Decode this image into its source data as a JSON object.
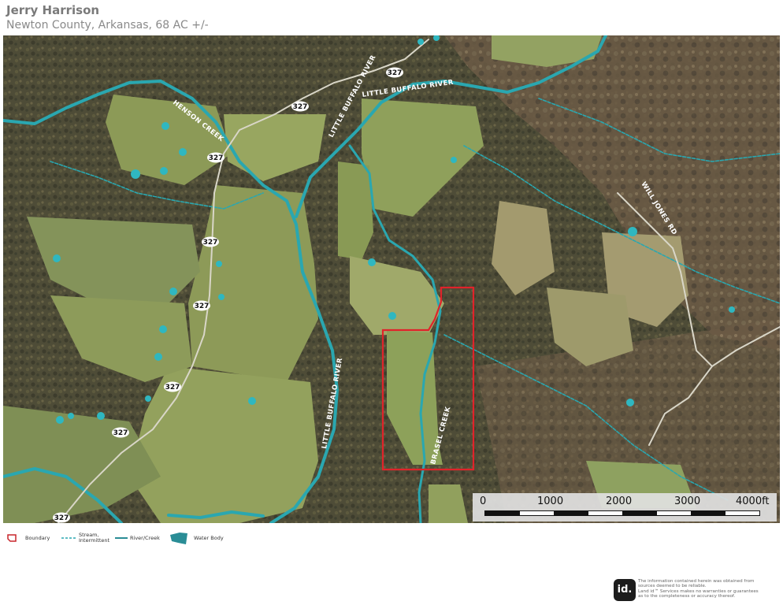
{
  "header": {
    "title": "Jerry Harrison",
    "subtitle": "Newton County, Arkansas, 68 AC +/-"
  },
  "map": {
    "labels": {
      "henson_creek": "HENSON CREEK",
      "little_buffalo_river_north": "LITTLE BUFFALO RIVER",
      "little_buffalo_river_label2": "LITTLE BUFFALO RIVER",
      "little_buffalo_river_south": "LITTLE BUFFALO RIVER",
      "brasel_creek": "BRASEL CREEK",
      "will_jones_rd": "WILL JONES RD"
    },
    "route_shield": "327",
    "colors": {
      "river": "#2aa7b0",
      "boundary": "#e0232a",
      "water_body": "#2fb7c0",
      "pasture": "#8fa05a",
      "forest": "#4b4a36"
    }
  },
  "scale": {
    "labels": [
      "0",
      "1000",
      "2000",
      "3000",
      "4000ft"
    ]
  },
  "legend": {
    "boundary": "Boundary",
    "stream_line1": "Stream,",
    "stream_line2": "Intermittent",
    "river": "River/Creek",
    "water_body": "Water Body"
  },
  "footer": {
    "logo": "id.",
    "disclaimer_lines": [
      "The information contained herein was obtained from",
      "sources deemed to be reliable.",
      "Land id™ Services makes no warranties or guarantees",
      "as to the completeness or accuracy thereof."
    ]
  }
}
